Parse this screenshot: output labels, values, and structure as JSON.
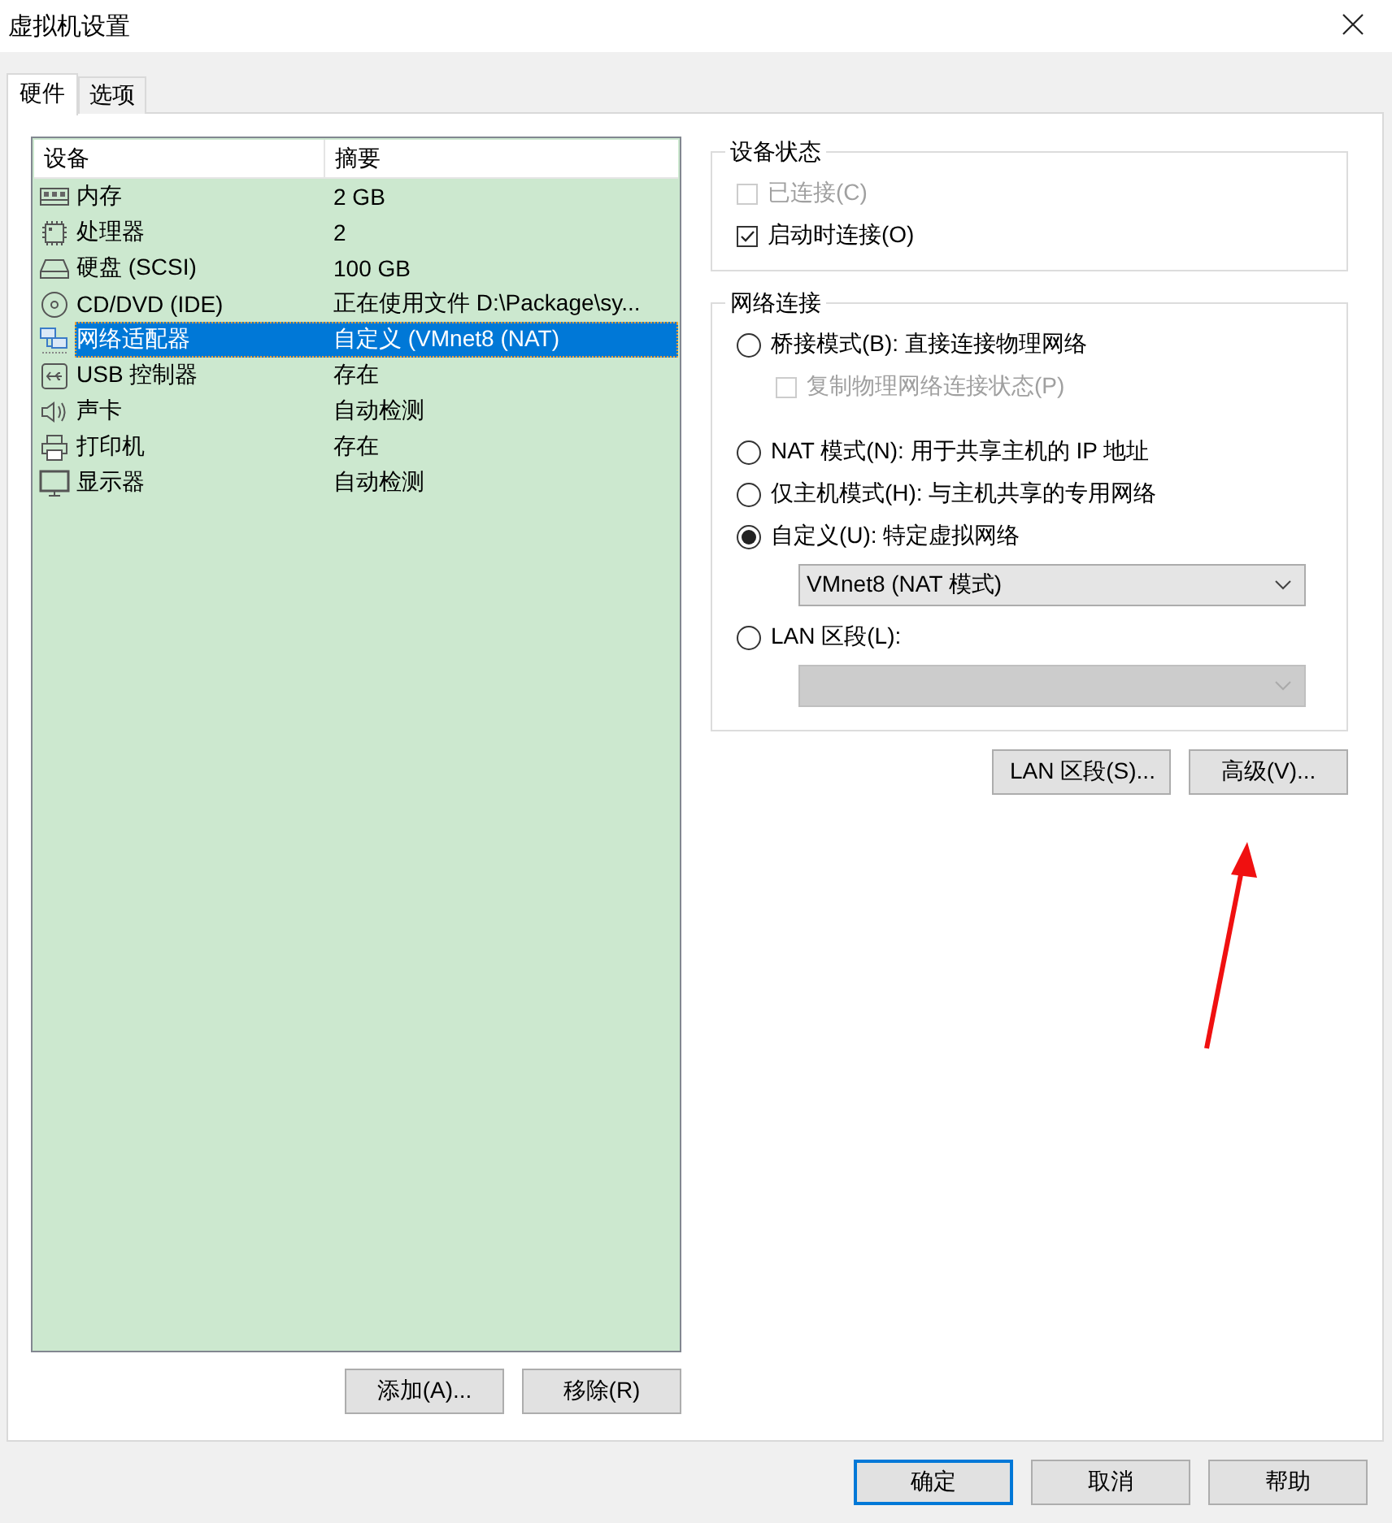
{
  "window": {
    "title": "虚拟机设置"
  },
  "tabs": [
    {
      "label": "硬件",
      "selected": true
    },
    {
      "label": "选项",
      "selected": false
    }
  ],
  "device_list": {
    "columns": [
      "设备",
      "摘要"
    ],
    "rows": [
      {
        "kind": "memory",
        "device": "内存",
        "summary": "2 GB",
        "selected": false
      },
      {
        "kind": "cpu",
        "device": "处理器",
        "summary": "2",
        "selected": false
      },
      {
        "kind": "disk",
        "device": "硬盘 (SCSI)",
        "summary": "100 GB",
        "selected": false
      },
      {
        "kind": "cdrom",
        "device": "CD/DVD (IDE)",
        "summary": "正在使用文件 D:\\Package\\sy...",
        "selected": false
      },
      {
        "kind": "network",
        "device": "网络适配器",
        "summary": "自定义 (VMnet8 (NAT)",
        "selected": true
      },
      {
        "kind": "usb",
        "device": "USB 控制器",
        "summary": "存在",
        "selected": false
      },
      {
        "kind": "sound",
        "device": "声卡",
        "summary": "自动检测",
        "selected": false
      },
      {
        "kind": "printer",
        "device": "打印机",
        "summary": "存在",
        "selected": false
      },
      {
        "kind": "display",
        "device": "显示器",
        "summary": "自动检测",
        "selected": false
      }
    ]
  },
  "list_buttons": [
    "添加(A)...",
    "移除(R)"
  ],
  "device_status": {
    "title": "设备状态",
    "options": [
      {
        "label": "已连接(C)",
        "checked": false,
        "disabled": true
      },
      {
        "label": "启动时连接(O)",
        "checked": true,
        "disabled": false
      }
    ]
  },
  "network": {
    "title": "网络连接",
    "items": [
      {
        "kind": "radio",
        "label": "桥接模式(B): 直接连接物理网络",
        "selected": false
      },
      {
        "kind": "checkbox",
        "label": "复制物理网络连接状态(P)",
        "checked": false,
        "disabled": true
      },
      {
        "kind": "radio",
        "label": "NAT 模式(N): 用于共享主机的 IP 地址",
        "selected": false
      },
      {
        "kind": "radio",
        "label": "仅主机模式(H): 与主机共享的专用网络",
        "selected": false
      },
      {
        "kind": "radio",
        "label": "自定义(U): 特定虚拟网络",
        "selected": true
      },
      {
        "kind": "dropdown",
        "value": "VMnet8 (NAT 模式)",
        "disabled": false
      },
      {
        "kind": "radio",
        "label": "LAN 区段(L):",
        "selected": false
      },
      {
        "kind": "dropdown",
        "disabled": true
      }
    ]
  },
  "network_buttons": [
    "LAN 区段(S)...",
    "高级(V)..."
  ],
  "dialog_buttons": [
    {
      "label": "确定",
      "default": true
    },
    {
      "label": "取消",
      "default": false
    },
    {
      "label": "帮助",
      "default": false
    }
  ]
}
